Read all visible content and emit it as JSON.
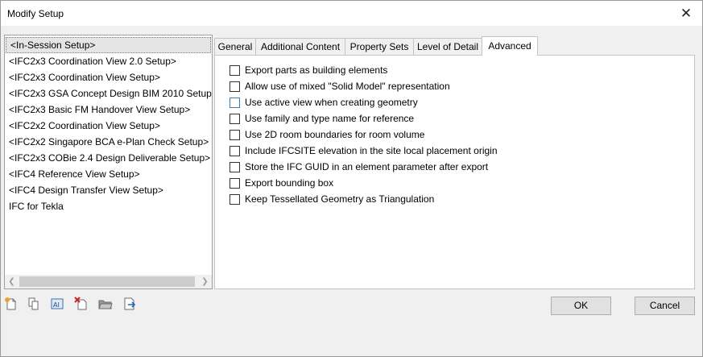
{
  "window": {
    "title": "Modify Setup"
  },
  "setups": [
    "<In-Session Setup>",
    "<IFC2x3 Coordination View 2.0 Setup>",
    "<IFC2x3 Coordination View Setup>",
    "<IFC2x3 GSA Concept Design BIM 2010 Setup>",
    "<IFC2x3 Basic FM Handover View Setup>",
    "<IFC2x2 Coordination View Setup>",
    "<IFC2x2 Singapore BCA e-Plan Check Setup>",
    "<IFC2x3 COBie 2.4 Design Deliverable Setup>",
    "<IFC4 Reference View Setup>",
    "<IFC4 Design Transfer View Setup>",
    "IFC for Tekla"
  ],
  "selected_setup": "<In-Session Setup>",
  "tabs": [
    {
      "label": "General"
    },
    {
      "label": "Additional Content"
    },
    {
      "label": "Property Sets"
    },
    {
      "label": "Level of Detail"
    },
    {
      "label": "Advanced"
    }
  ],
  "active_tab": "Advanced",
  "options": [
    {
      "label": "Export parts as building elements",
      "checked": false
    },
    {
      "label": "Allow use of mixed \"Solid Model\" representation",
      "checked": false
    },
    {
      "label": "Use active view when creating geometry",
      "checked": false,
      "focused": true
    },
    {
      "label": "Use family and type name for reference",
      "checked": false
    },
    {
      "label": "Use 2D room boundaries for room volume",
      "checked": false
    },
    {
      "label": "Include IFCSITE elevation in the site local placement origin",
      "checked": false
    },
    {
      "label": "Store the IFC GUID in an element parameter after export",
      "checked": false
    },
    {
      "label": "Export bounding box",
      "checked": false
    },
    {
      "label": "Keep Tessellated Geometry as Triangulation",
      "checked": false
    }
  ],
  "toolbar_icons": [
    "new-setup-icon",
    "duplicate-setup-icon",
    "rename-setup-icon",
    "delete-setup-icon",
    "import-setup-icon",
    "export-setup-icon"
  ],
  "buttons": {
    "ok": "OK",
    "cancel": "Cancel"
  },
  "icons": {
    "close": "close-icon"
  }
}
